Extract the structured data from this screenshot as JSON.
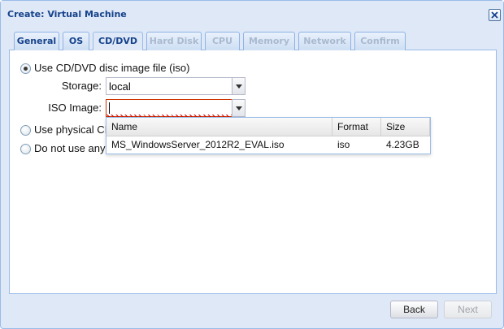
{
  "window": {
    "title": "Create: Virtual Machine"
  },
  "tabs": [
    {
      "label": "General",
      "state": "normal"
    },
    {
      "label": "OS",
      "state": "normal"
    },
    {
      "label": "CD/DVD",
      "state": "active"
    },
    {
      "label": "Hard Disk",
      "state": "disabled"
    },
    {
      "label": "CPU",
      "state": "disabled"
    },
    {
      "label": "Memory",
      "state": "disabled"
    },
    {
      "label": "Network",
      "state": "disabled"
    },
    {
      "label": "Confirm",
      "state": "disabled"
    }
  ],
  "options": {
    "iso_label": "Use CD/DVD disc image file (iso)",
    "physical_label": "Use physical CD",
    "none_label": "Do not use any r",
    "selected": "iso"
  },
  "fields": {
    "storage_label": "Storage:",
    "storage_value": "local",
    "iso_label": "ISO Image:",
    "iso_value": ""
  },
  "dropdown": {
    "columns": [
      "Name",
      "Format",
      "Size"
    ],
    "rows": [
      {
        "name": "MS_WindowsServer_2012R2_EVAL.iso",
        "format": "iso",
        "size": "4.23GB"
      }
    ]
  },
  "buttons": {
    "back": "Back",
    "next": "Next"
  }
}
